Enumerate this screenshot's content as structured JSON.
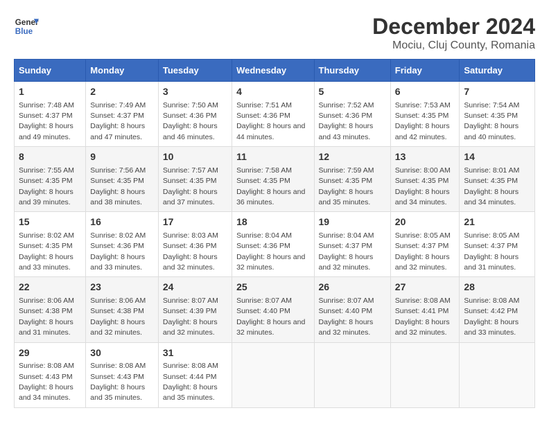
{
  "header": {
    "logo_line1": "General",
    "logo_line2": "Blue",
    "main_title": "December 2024",
    "subtitle": "Mociu, Cluj County, Romania"
  },
  "days_of_week": [
    "Sunday",
    "Monday",
    "Tuesday",
    "Wednesday",
    "Thursday",
    "Friday",
    "Saturday"
  ],
  "weeks": [
    [
      {
        "day": 1,
        "sunrise": "7:48 AM",
        "sunset": "4:37 PM",
        "daylight": "8 hours and 49 minutes."
      },
      {
        "day": 2,
        "sunrise": "7:49 AM",
        "sunset": "4:37 PM",
        "daylight": "8 hours and 47 minutes."
      },
      {
        "day": 3,
        "sunrise": "7:50 AM",
        "sunset": "4:36 PM",
        "daylight": "8 hours and 46 minutes."
      },
      {
        "day": 4,
        "sunrise": "7:51 AM",
        "sunset": "4:36 PM",
        "daylight": "8 hours and 44 minutes."
      },
      {
        "day": 5,
        "sunrise": "7:52 AM",
        "sunset": "4:36 PM",
        "daylight": "8 hours and 43 minutes."
      },
      {
        "day": 6,
        "sunrise": "7:53 AM",
        "sunset": "4:35 PM",
        "daylight": "8 hours and 42 minutes."
      },
      {
        "day": 7,
        "sunrise": "7:54 AM",
        "sunset": "4:35 PM",
        "daylight": "8 hours and 40 minutes."
      }
    ],
    [
      {
        "day": 8,
        "sunrise": "7:55 AM",
        "sunset": "4:35 PM",
        "daylight": "8 hours and 39 minutes."
      },
      {
        "day": 9,
        "sunrise": "7:56 AM",
        "sunset": "4:35 PM",
        "daylight": "8 hours and 38 minutes."
      },
      {
        "day": 10,
        "sunrise": "7:57 AM",
        "sunset": "4:35 PM",
        "daylight": "8 hours and 37 minutes."
      },
      {
        "day": 11,
        "sunrise": "7:58 AM",
        "sunset": "4:35 PM",
        "daylight": "8 hours and 36 minutes."
      },
      {
        "day": 12,
        "sunrise": "7:59 AM",
        "sunset": "4:35 PM",
        "daylight": "8 hours and 35 minutes."
      },
      {
        "day": 13,
        "sunrise": "8:00 AM",
        "sunset": "4:35 PM",
        "daylight": "8 hours and 34 minutes."
      },
      {
        "day": 14,
        "sunrise": "8:01 AM",
        "sunset": "4:35 PM",
        "daylight": "8 hours and 34 minutes."
      }
    ],
    [
      {
        "day": 15,
        "sunrise": "8:02 AM",
        "sunset": "4:35 PM",
        "daylight": "8 hours and 33 minutes."
      },
      {
        "day": 16,
        "sunrise": "8:02 AM",
        "sunset": "4:36 PM",
        "daylight": "8 hours and 33 minutes."
      },
      {
        "day": 17,
        "sunrise": "8:03 AM",
        "sunset": "4:36 PM",
        "daylight": "8 hours and 32 minutes."
      },
      {
        "day": 18,
        "sunrise": "8:04 AM",
        "sunset": "4:36 PM",
        "daylight": "8 hours and 32 minutes."
      },
      {
        "day": 19,
        "sunrise": "8:04 AM",
        "sunset": "4:37 PM",
        "daylight": "8 hours and 32 minutes."
      },
      {
        "day": 20,
        "sunrise": "8:05 AM",
        "sunset": "4:37 PM",
        "daylight": "8 hours and 32 minutes."
      },
      {
        "day": 21,
        "sunrise": "8:05 AM",
        "sunset": "4:37 PM",
        "daylight": "8 hours and 31 minutes."
      }
    ],
    [
      {
        "day": 22,
        "sunrise": "8:06 AM",
        "sunset": "4:38 PM",
        "daylight": "8 hours and 31 minutes."
      },
      {
        "day": 23,
        "sunrise": "8:06 AM",
        "sunset": "4:38 PM",
        "daylight": "8 hours and 32 minutes."
      },
      {
        "day": 24,
        "sunrise": "8:07 AM",
        "sunset": "4:39 PM",
        "daylight": "8 hours and 32 minutes."
      },
      {
        "day": 25,
        "sunrise": "8:07 AM",
        "sunset": "4:40 PM",
        "daylight": "8 hours and 32 minutes."
      },
      {
        "day": 26,
        "sunrise": "8:07 AM",
        "sunset": "4:40 PM",
        "daylight": "8 hours and 32 minutes."
      },
      {
        "day": 27,
        "sunrise": "8:08 AM",
        "sunset": "4:41 PM",
        "daylight": "8 hours and 32 minutes."
      },
      {
        "day": 28,
        "sunrise": "8:08 AM",
        "sunset": "4:42 PM",
        "daylight": "8 hours and 33 minutes."
      }
    ],
    [
      {
        "day": 29,
        "sunrise": "8:08 AM",
        "sunset": "4:43 PM",
        "daylight": "8 hours and 34 minutes."
      },
      {
        "day": 30,
        "sunrise": "8:08 AM",
        "sunset": "4:43 PM",
        "daylight": "8 hours and 35 minutes."
      },
      {
        "day": 31,
        "sunrise": "8:08 AM",
        "sunset": "4:44 PM",
        "daylight": "8 hours and 35 minutes."
      },
      null,
      null,
      null,
      null
    ]
  ]
}
